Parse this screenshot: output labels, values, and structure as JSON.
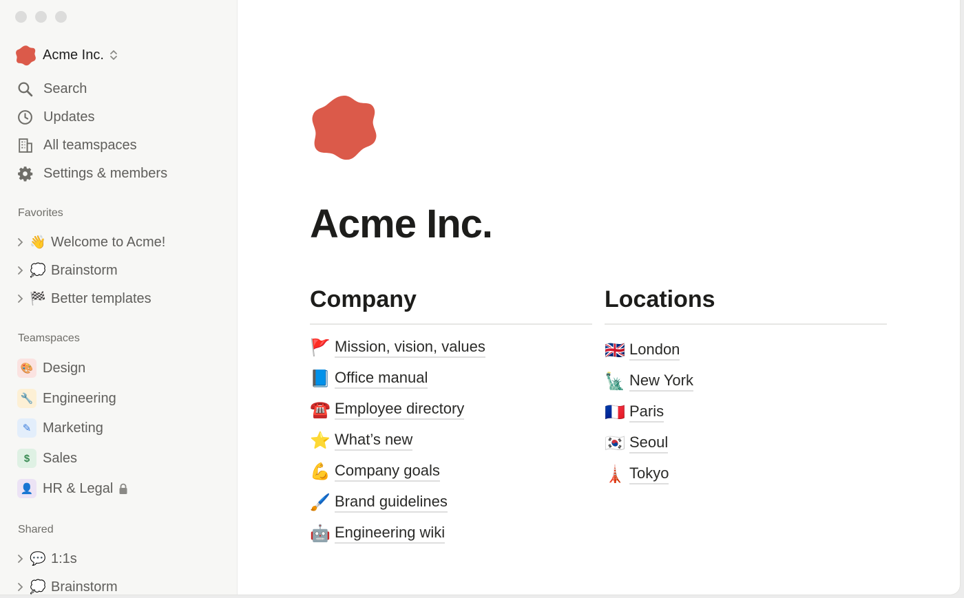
{
  "workspace": {
    "name": "Acme Inc."
  },
  "nav": [
    {
      "label": "Search",
      "icon": "search-icon"
    },
    {
      "label": "Updates",
      "icon": "clock-icon"
    },
    {
      "label": "All teamspaces",
      "icon": "building-icon"
    },
    {
      "label": "Settings & members",
      "icon": "gear-icon"
    }
  ],
  "favorites": {
    "heading": "Favorites",
    "items": [
      {
        "emoji": "👋",
        "label": "Welcome to Acme!"
      },
      {
        "emoji": "💭",
        "label": "Brainstorm"
      },
      {
        "emoji": "🏁",
        "label": "Better templates"
      }
    ]
  },
  "teamspaces": {
    "heading": "Teamspaces",
    "items": [
      {
        "glyph": "🎨",
        "label": "Design",
        "tile_color": "#fbe3e1",
        "glyph_color": "#d9574a"
      },
      {
        "glyph": "🔧",
        "label": "Engineering",
        "tile_color": "#fdf0d5",
        "glyph_color": "#d19a2a"
      },
      {
        "glyph": "✎",
        "label": "Marketing",
        "tile_color": "#e3eefb",
        "glyph_color": "#3b7ddd"
      },
      {
        "glyph": "$",
        "label": "Sales",
        "tile_color": "#dff1e4",
        "glyph_color": "#3a8a53"
      },
      {
        "glyph": "👤",
        "label": "HR & Legal",
        "tile_color": "#ece3f5",
        "glyph_color": "#8a5cbf",
        "locked": true
      }
    ]
  },
  "shared": {
    "heading": "Shared",
    "items": [
      {
        "emoji": "💬",
        "label": "1:1s"
      },
      {
        "emoji": "💭",
        "label": "Brainstorm"
      }
    ]
  },
  "page": {
    "title": "Acme Inc.",
    "icon_color": "#db5a4a"
  },
  "company": {
    "heading": "Company",
    "links": [
      {
        "emoji": "🚩",
        "label": "Mission, vision, values"
      },
      {
        "emoji": "📘",
        "label": "Office manual"
      },
      {
        "emoji": "☎️",
        "label": "Employee directory"
      },
      {
        "emoji": "⭐",
        "label": "What’s new"
      },
      {
        "emoji": "💪",
        "label": "Company goals"
      },
      {
        "emoji": "🖌️",
        "label": "Brand guidelines"
      },
      {
        "emoji": "🤖",
        "label": "Engineering wiki"
      }
    ]
  },
  "locations": {
    "heading": "Locations",
    "links": [
      {
        "emoji": "🇬🇧",
        "label": "London"
      },
      {
        "emoji": "🗽",
        "label": "New York"
      },
      {
        "emoji": "🇫🇷",
        "label": "Paris"
      },
      {
        "emoji": "🇰🇷",
        "label": "Seoul"
      },
      {
        "emoji": "🗼",
        "label": "Tokyo"
      }
    ]
  }
}
